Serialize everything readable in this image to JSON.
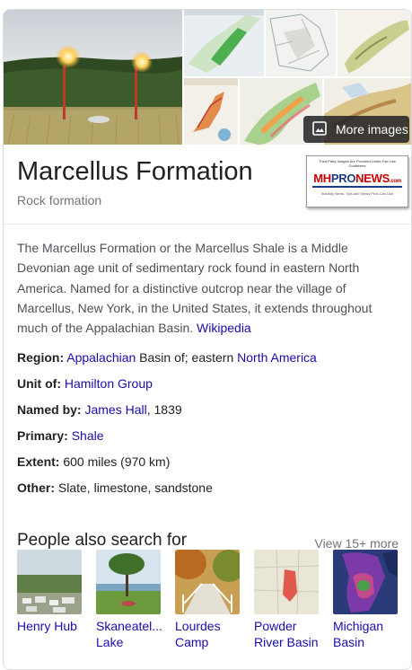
{
  "images": {
    "more_images_label": "More images"
  },
  "logo": {
    "top_text": "Third Party Images Are Provided Under Fair Use Guidelines",
    "main_left": "MH",
    "main_mid": "PRO",
    "main_right": "NEWS",
    "main_suffix": ".com",
    "sub_text": "Industry News, Tips and Views Pros Can Use"
  },
  "entity": {
    "title": "Marcellus Formation",
    "subtitle": "Rock formation"
  },
  "description": {
    "text": "The Marcellus Formation or the Marcellus Shale is a Middle Devonian age unit of sedimentary rock found in eastern North America. Named for a distinctive outcrop near the village of Marcellus, New York, in the United States, it extends throughout much of the Appalachian Basin.",
    "source_link": "Wikipedia"
  },
  "facts": {
    "region": {
      "label": "Region:",
      "link1": "Appalachian",
      "text1": " Basin of; eastern ",
      "link2": "North America"
    },
    "unit_of": {
      "label": "Unit of:",
      "link": "Hamilton Group"
    },
    "named_by": {
      "label": "Named by:",
      "link": "James Hall",
      "text": ", 1839"
    },
    "primary": {
      "label": "Primary:",
      "link": "Shale"
    },
    "extent": {
      "label": "Extent:",
      "text": "600 miles (970 km)"
    },
    "other": {
      "label": "Other:",
      "text": "Slate, limestone, sandstone"
    }
  },
  "people_also_search": {
    "title": "People also search for",
    "view_more": "View 15+ more",
    "items": [
      {
        "line1": "Henry Hub",
        "line2": ""
      },
      {
        "line1": "Skaneatel...",
        "line2": "Lake"
      },
      {
        "line1": "Lourdes",
        "line2": "Camp"
      },
      {
        "line1": "Powder",
        "line2": "River Basin"
      },
      {
        "line1": "Michigan",
        "line2": "Basin"
      }
    ]
  },
  "colors": {
    "link": "#1a0dab",
    "muted": "#70757a",
    "text": "#4d5156",
    "logo_red": "#cc0000",
    "logo_blue": "#1a3a8a"
  }
}
